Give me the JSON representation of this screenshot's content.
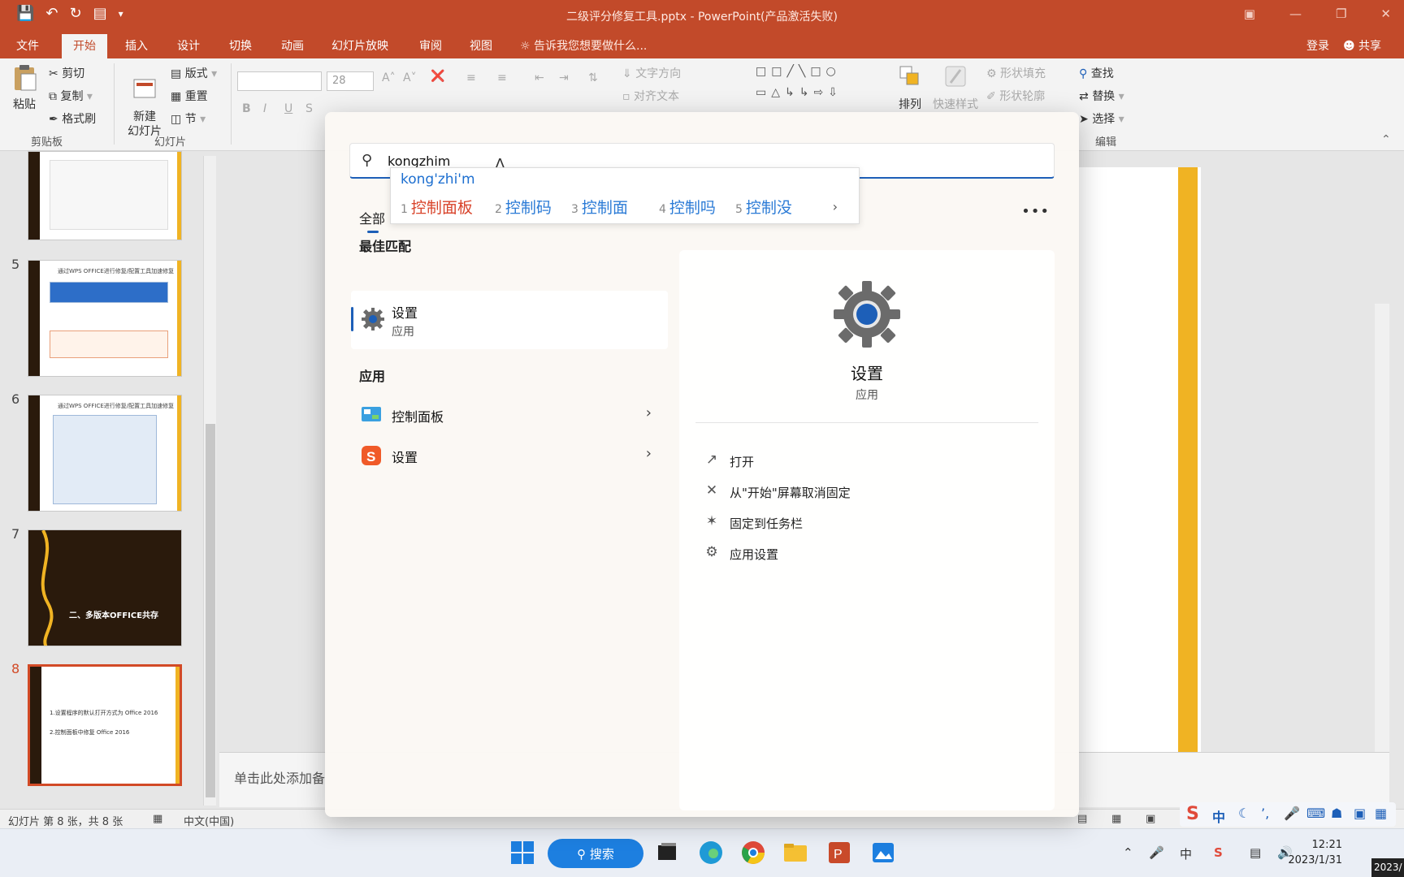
{
  "window": {
    "title": "二级评分修复工具.pptx - PowerPoint(产品激活失败)"
  },
  "ribbon_tabs": [
    "文件",
    "开始",
    "插入",
    "设计",
    "切换",
    "动画",
    "幻灯片放映",
    "审阅",
    "视图"
  ],
  "tell_me": "告诉我您想要做什么...",
  "account": {
    "login": "登录",
    "share": "共享"
  },
  "ribbon": {
    "paste": "粘贴",
    "cut": "剪切",
    "copy": "复制",
    "format_painter": "格式刷",
    "clipboard_group": "剪贴板",
    "new_slide": "新建\n幻灯片",
    "layout": "版式",
    "reset": "重置",
    "section": "节",
    "slides_group": "幻灯片",
    "font_size": "28",
    "text_direction": "文字方向",
    "align_text": "对齐文本",
    "arrange": "排列",
    "quick_styles": "快速样式",
    "shape_fill": "形状填充",
    "shape_outline": "形状轮廓",
    "find": "查找",
    "replace": "替换",
    "select": "选择",
    "editing_group": "编辑"
  },
  "thumbnails": [
    {
      "num": "5",
      "title": "通过WPS OFFICE进行修复/配置工具加速修复"
    },
    {
      "num": "6",
      "title": "通过WPS OFFICE进行修复/配置工具加速修复"
    },
    {
      "num": "7",
      "title": "二、多版本OFFICE共存"
    },
    {
      "num": "8",
      "line1": "1.设置程序的默认打开方式为 Office 2016",
      "line2": "2.控制面板中修复 Office 2016"
    }
  ],
  "notes_placeholder": "单击此处添加备",
  "status": {
    "slide_info": "幻灯片 第 8 张，共 8 张",
    "language": "中文(中国)"
  },
  "search": {
    "query": "kongzhim",
    "ime_composition": "kong'zhi'm",
    "ime_candidates": [
      {
        "n": "1",
        "text": "控制面板"
      },
      {
        "n": "2",
        "text": "控制码"
      },
      {
        "n": "3",
        "text": "控制面"
      },
      {
        "n": "4",
        "text": "控制吗"
      },
      {
        "n": "5",
        "text": "控制没"
      }
    ],
    "filter_all": "全部",
    "best_match_header": "最佳匹配",
    "best_match": {
      "name": "设置",
      "type": "应用"
    },
    "apps_header": "应用",
    "apps": [
      {
        "name": "控制面板"
      },
      {
        "name": "设置"
      }
    ],
    "detail": {
      "name": "设置",
      "type": "应用",
      "actions": [
        {
          "label": "打开",
          "icon": "open-icon"
        },
        {
          "label": "从\"开始\"屏幕取消固定",
          "icon": "unpin-icon"
        },
        {
          "label": "固定到任务栏",
          "icon": "pin-icon"
        },
        {
          "label": "应用设置",
          "icon": "gear-icon"
        }
      ]
    }
  },
  "taskbar": {
    "search_label": "搜索",
    "tray_lang": "中",
    "ime_tray_lang": "中",
    "time": "12:21",
    "date": "2023/1/31",
    "corner": "2023/"
  },
  "colors": {
    "ppt_accent": "#c24a2a",
    "slide_bar": "#f0b323",
    "windows_blue": "#1d5fb8"
  }
}
